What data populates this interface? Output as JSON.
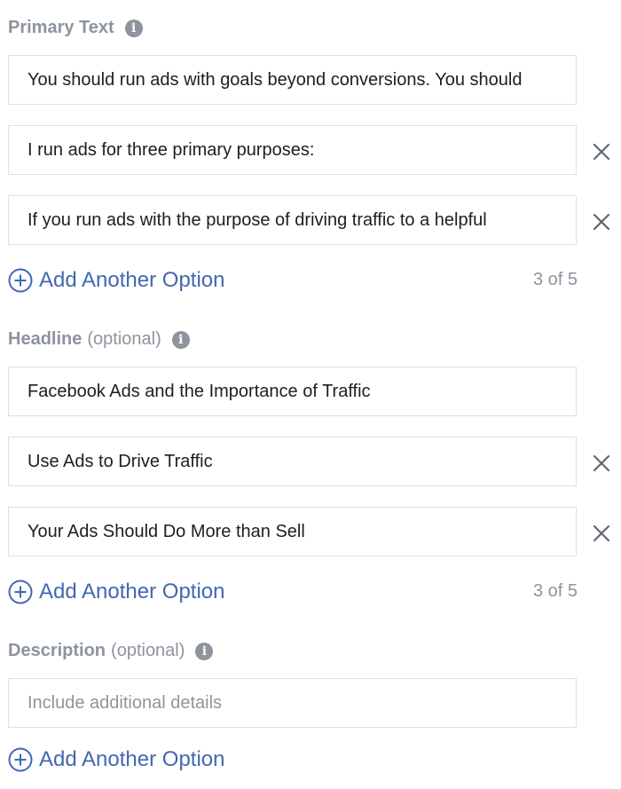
{
  "primary_text": {
    "label": "Primary Text",
    "options": [
      "You should run ads with goals beyond conversions. You should",
      "I run ads for three primary purposes:",
      "If you run ads with the purpose of driving traffic to a helpful"
    ],
    "add_label": "Add Another Option",
    "count": "3 of 5"
  },
  "headline": {
    "label": "Headline",
    "optional": "(optional)",
    "options": [
      "Facebook Ads and the Importance of Traffic",
      "Use Ads to Drive Traffic",
      "Your Ads Should Do More than Sell"
    ],
    "add_label": "Add Another Option",
    "count": "3 of 5"
  },
  "description": {
    "label": "Description",
    "optional": "(optional)",
    "placeholder": "Include additional details",
    "add_label": "Add Another Option"
  },
  "icons": {
    "info": "info-icon",
    "remove": "close-icon",
    "add": "plus-circle-icon"
  },
  "colors": {
    "link": "#4267b2",
    "muted": "#8d949e",
    "text": "#1c1e21",
    "border": "#dddfe2"
  }
}
